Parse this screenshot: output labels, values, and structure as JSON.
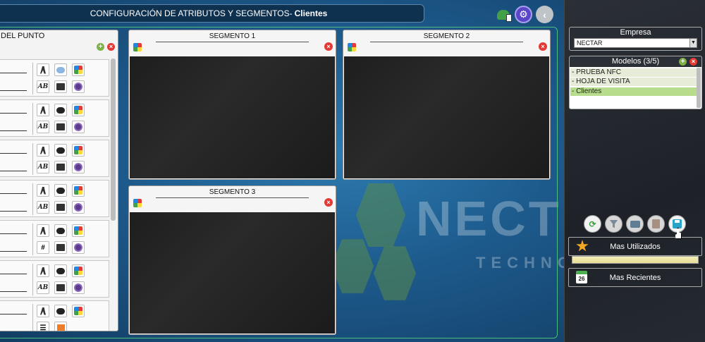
{
  "header": {
    "title_prefix": "CONFIGURACIÓN DE ATRIBUTOS Y SEGMENTOS-",
    "title_model": "Clientes"
  },
  "attributes_panel": {
    "header": "DEL PUNTO",
    "row_count": 7,
    "special_text": "#"
  },
  "segments": [
    {
      "title": "SEGMENTO 1"
    },
    {
      "title": "SEGMENTO 2"
    },
    {
      "title": "SEGMENTO 3"
    }
  ],
  "watermark": {
    "line1": "NECT",
    "line2": "TECHNO"
  },
  "sidebar": {
    "empresa_label": "Empresa",
    "empresa_value": "NECTAR",
    "modelos_label": "Modelos (3/5)",
    "modelos": [
      "- PRUEBA NFC",
      "- HOJA DE VISITA",
      "- Clientes"
    ],
    "selected_model_index": 2,
    "mas_utilizados": "Mas Utilizados",
    "mas_recientes": "Mas Recientes",
    "calendar_day": "26"
  },
  "colors": {
    "accent_green": "#4bbf7b",
    "title_bg": "#0f3150",
    "sidebar_bg": "#2b2f36",
    "selected_row": "#b7dd8c",
    "delete_red": "#e53935"
  },
  "icons": {
    "top": [
      "device-sync-icon",
      "settings-icon",
      "back-arrow-icon"
    ],
    "tools": [
      "refresh-icon",
      "filter-icon",
      "print-icon",
      "copy-icon",
      "save-icon"
    ]
  }
}
